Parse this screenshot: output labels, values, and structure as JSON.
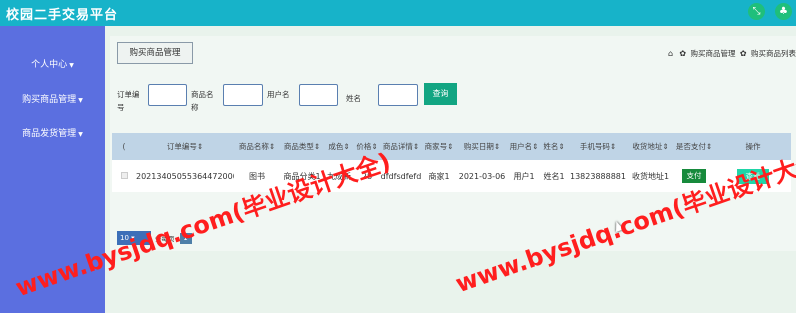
{
  "app": {
    "title": "校园二手交易平台"
  },
  "topbar": {
    "icon1": "⤡",
    "icon2": "♣"
  },
  "sidebar": {
    "items": [
      {
        "label": "个人中心"
      },
      {
        "label": "购买商品管理"
      },
      {
        "label": "商品发货管理"
      }
    ]
  },
  "tab": {
    "label": "购买商品管理"
  },
  "breadcrumb": {
    "sep1": "✿",
    "item1": "购买商品管理",
    "sep2": "✿",
    "item2": "购买商品列表"
  },
  "search": {
    "fields": [
      {
        "label": "订单编号",
        "value": ""
      },
      {
        "label": "商品名称",
        "value": ""
      },
      {
        "label": "用户名",
        "value": ""
      },
      {
        "label": "姓名",
        "value": ""
      }
    ],
    "button": "查询"
  },
  "table": {
    "columns": [
      "",
      "订单编号",
      "商品名称",
      "商品类型",
      "成色",
      "价格",
      "商品详情",
      "商家号",
      "购买日期",
      "用户名",
      "姓名",
      "手机号码",
      "收货地址",
      "是否支付",
      "操作"
    ],
    "rows": [
      {
        "order_no": "20213405055364472000",
        "product_name": "图书",
        "product_type": "商品分类1",
        "condition": "九成新",
        "price": "28",
        "detail": "dfdfsdfefd",
        "merchant": "商家1",
        "date": "2021-03-06",
        "username": "用户1",
        "name": "姓名1",
        "phone": "13823888881",
        "address": "收货地址1",
        "pay_label": "支付",
        "action_label": "查看"
      }
    ]
  },
  "pagination": {
    "page_size": "10",
    "label": "条每页",
    "current_page": "1"
  },
  "watermarks": [
    "www.bysjdq.com(毕业设计大全)",
    "www.bysjdq.com(毕业设计大全)"
  ]
}
